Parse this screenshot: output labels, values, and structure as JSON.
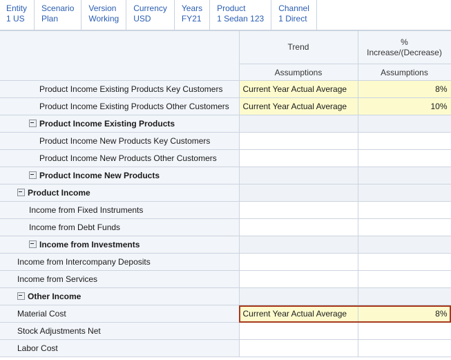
{
  "pov": {
    "items": [
      {
        "dimension": "Entity",
        "member": "1 US"
      },
      {
        "dimension": "Scenario",
        "member": "Plan"
      },
      {
        "dimension": "Version",
        "member": "Working"
      },
      {
        "dimension": "Currency",
        "member": "USD"
      },
      {
        "dimension": "Years",
        "member": "FY21"
      },
      {
        "dimension": "Product",
        "member": "1 Sedan 123"
      },
      {
        "dimension": "Channel",
        "member": "1 Direct"
      }
    ]
  },
  "grid": {
    "corner_label": "",
    "columns": [
      {
        "top": "Trend",
        "sub": "Assumptions"
      },
      {
        "top": "% Increase/(Decrease)",
        "sub": "Assumptions"
      }
    ],
    "column_top_1": "Trend",
    "column_top_2_line1": "%",
    "column_top_2_line2": "Increase/(Decrease)",
    "column_sub_1": "Assumptions",
    "column_sub_2": "Assumptions",
    "rows": [
      {
        "label": "Product Income Existing Products Key Customers",
        "level": 2,
        "parent": false,
        "toggle": false,
        "trend": "Current Year Actual Average",
        "pct": "8%",
        "trend_state": "dirty",
        "pct_state": "dirty",
        "selected": false
      },
      {
        "label": "Product Income Existing Products Other Customers",
        "level": 2,
        "parent": false,
        "toggle": false,
        "trend": "Current Year Actual Average",
        "pct": "10%",
        "trend_state": "dirty",
        "pct_state": "dirty",
        "selected": false
      },
      {
        "label": "Product Income Existing Products",
        "level": 1,
        "parent": true,
        "toggle": true,
        "trend": "",
        "pct": "",
        "trend_state": "summary",
        "pct_state": "summary",
        "selected": false
      },
      {
        "label": "Product Income New Products Key Customers",
        "level": 2,
        "parent": false,
        "toggle": false,
        "trend": "",
        "pct": "",
        "trend_state": "normal",
        "pct_state": "normal",
        "selected": false
      },
      {
        "label": "Product Income New Products Other Customers",
        "level": 2,
        "parent": false,
        "toggle": false,
        "trend": "",
        "pct": "",
        "trend_state": "normal",
        "pct_state": "normal",
        "selected": false
      },
      {
        "label": "Product Income New Products",
        "level": 1,
        "parent": true,
        "toggle": true,
        "trend": "",
        "pct": "",
        "trend_state": "summary",
        "pct_state": "summary",
        "selected": false
      },
      {
        "label": "Product Income",
        "level": 0,
        "parent": true,
        "toggle": true,
        "trend": "",
        "pct": "",
        "trend_state": "summary",
        "pct_state": "summary",
        "selected": false
      },
      {
        "label": "Income from Fixed Instruments",
        "level": 1,
        "parent": false,
        "toggle": false,
        "trend": "",
        "pct": "",
        "trend_state": "normal",
        "pct_state": "normal",
        "selected": false
      },
      {
        "label": "Income from Debt Funds",
        "level": 1,
        "parent": false,
        "toggle": false,
        "trend": "",
        "pct": "",
        "trend_state": "normal",
        "pct_state": "normal",
        "selected": false
      },
      {
        "label": "Income from Investments",
        "level": 1,
        "parent": true,
        "toggle": true,
        "trend": "",
        "pct": "",
        "trend_state": "summary",
        "pct_state": "summary",
        "selected": false
      },
      {
        "label": "Income from Intercompany Deposits",
        "level": 0,
        "parent": false,
        "toggle": false,
        "trend": "",
        "pct": "",
        "trend_state": "normal",
        "pct_state": "normal",
        "selected": false
      },
      {
        "label": "Income from Services",
        "level": 0,
        "parent": false,
        "toggle": false,
        "trend": "",
        "pct": "",
        "trend_state": "normal",
        "pct_state": "normal",
        "selected": false
      },
      {
        "label": "Other Income",
        "level": 0,
        "parent": true,
        "toggle": true,
        "trend": "",
        "pct": "",
        "trend_state": "summary",
        "pct_state": "summary",
        "selected": false
      },
      {
        "label": "Material Cost",
        "level": 0,
        "parent": false,
        "toggle": false,
        "trend": "Current Year Actual Average",
        "pct": "8%",
        "trend_state": "dirty",
        "pct_state": "dirty",
        "selected": true
      },
      {
        "label": "Stock Adjustments Net",
        "level": 0,
        "parent": false,
        "toggle": false,
        "trend": "",
        "pct": "",
        "trend_state": "normal",
        "pct_state": "normal",
        "selected": false
      },
      {
        "label": "Labor Cost",
        "level": 0,
        "parent": false,
        "toggle": false,
        "trend": "",
        "pct": "",
        "trend_state": "normal",
        "pct_state": "normal",
        "selected": false
      }
    ]
  },
  "colors": {
    "pov_text": "#2a5db0",
    "header_bg": "#f2f5f9",
    "row_label_bg": "#f2f5f9",
    "summary_cell_bg": "#eff2f7",
    "dirty_cell_bg": "#fdfbcd",
    "grid_line": "#ccd4e0",
    "selection_border": "#a6381c"
  }
}
